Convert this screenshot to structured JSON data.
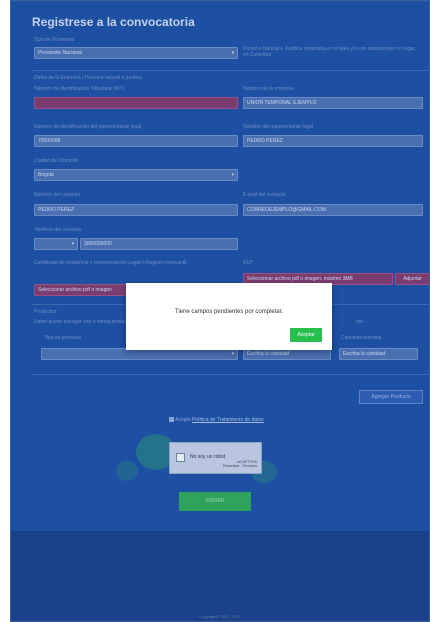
{
  "page_title": "Registrese a la convocatoria",
  "form": {
    "tipo_proveedor": {
      "label": "Tipo de Proveedor",
      "value": "Proveedor Nacional"
    },
    "tipo_proveedor_help": "Persona Natural o Jurídica registrada en el país y/o con operaciones en lugar en Colombia",
    "section_empresa": "Datos de la Empresa / Persona natural o jurídica",
    "nit": {
      "label": "Número de Identificación Tributaria (NIT)",
      "value": ""
    },
    "razon_social": {
      "label": "Nombre de la empresa",
      "value": "UNION TEMPORAL EJEMPLO"
    },
    "doc_representante": {
      "label": "Número de identificación del representante legal",
      "value": "70000008"
    },
    "nombre_representante": {
      "label": "Nombre del representante legal",
      "value": "PEDRO PEREZ"
    },
    "ciudad": {
      "label": "Ciudad de Domicilio",
      "value": "Bogotá"
    },
    "nombre_contacto": {
      "label": "Nombre del contacto",
      "value": "PEDRO PEREZ"
    },
    "email_contacto": {
      "label": "E-mail del contacto",
      "value": "CORREOEJEMPLO@GMAIL.COM"
    },
    "telefono_contacto": {
      "label": "Teléfono del contacto",
      "prefix": "",
      "value": "3000000000"
    },
    "certificado": {
      "label": "Certificado de existencia y representación Legal o Registro mercantil",
      "placeholder": "Seleccionar archivo pdf o imagen"
    },
    "rut": {
      "label": "RUT",
      "placeholder": "Seleccionar archivo pdf o imagen, máximo 3MB",
      "button": "Adjuntar"
    },
    "section_productos": "Productos",
    "productos_help": "Usted puede escoger uno o varios productos para participar en la convocatoria",
    "productos_help_right": "ma",
    "tipo_producto": {
      "label": "Tipo de producto",
      "value": ""
    },
    "cantidad_mensual": {
      "label": "",
      "placeholder": "Escriba la cantidad"
    },
    "cantidad_semanal": {
      "label": "Cantidad semanal",
      "placeholder": "Escriba la cantidad"
    },
    "agregar_producto": "Agregar Producto",
    "acepto_text": "Acepto",
    "politica_link": "Política de Tratamiento de datos",
    "captcha": {
      "label": "No soy un robot",
      "brand": "reCAPTCHA",
      "terms": "Privacidad - Términos"
    },
    "enviar": "ENVIAR"
  },
  "modal": {
    "message": "Tiene campos pendientes por completar.",
    "ok": "Aceptar"
  },
  "footer": {
    "text": "Copyright© 2021 · CFT"
  },
  "colors": {
    "page_bg": "#1d4fa3",
    "accept_button": "#27c04f",
    "invalid_field": "#7a3d6f"
  }
}
